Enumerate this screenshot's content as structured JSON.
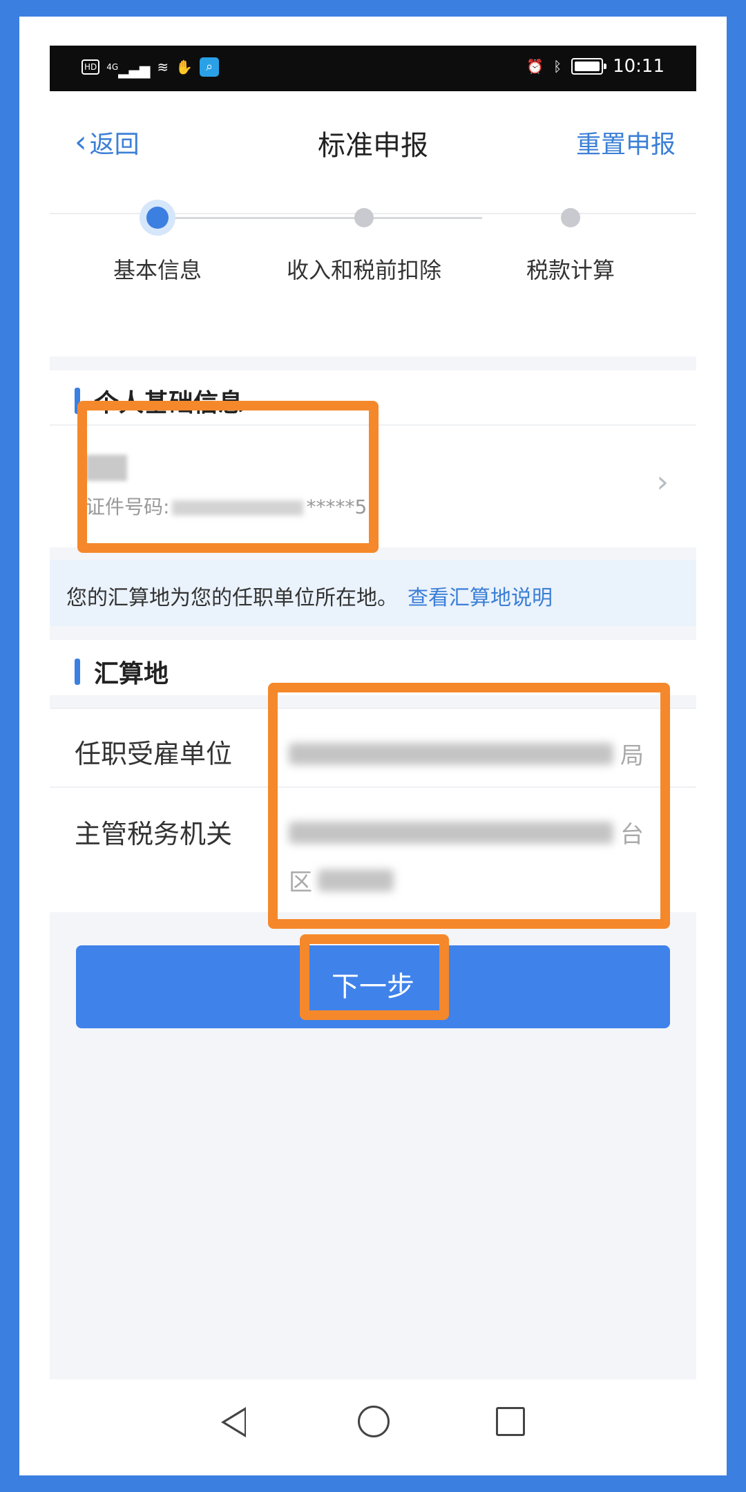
{
  "status_bar": {
    "hd": "HD",
    "network": "4G",
    "time": "10:11"
  },
  "navbar": {
    "back_label": "返回",
    "title": "标准申报",
    "reset_label": "重置申报"
  },
  "steps": [
    {
      "label": "基本信息",
      "state": "active"
    },
    {
      "label": "收入和税前扣除",
      "state": "pending"
    },
    {
      "label": "税款计算",
      "state": "pending"
    }
  ],
  "personal_section": {
    "title": "个人基础信息",
    "id_prefix": "证件号码",
    "id_masked_suffix": "*****",
    "id_tail": "5"
  },
  "notice": {
    "text": "您的汇算地为您的任职单位所在地。",
    "link": "查看汇算地说明"
  },
  "settlement_section": {
    "title": "汇算地",
    "employer_label": "任职受雇单位",
    "employer_value_end": "局",
    "tax_authority_label": "主管税务机关",
    "tax_authority_value_end": "台",
    "tax_authority_line2_start": "区"
  },
  "next_button": "下一步",
  "colors": {
    "accent": "#3b7fe0",
    "highlight": "#f5882b",
    "frame": "#3b7fe0"
  }
}
